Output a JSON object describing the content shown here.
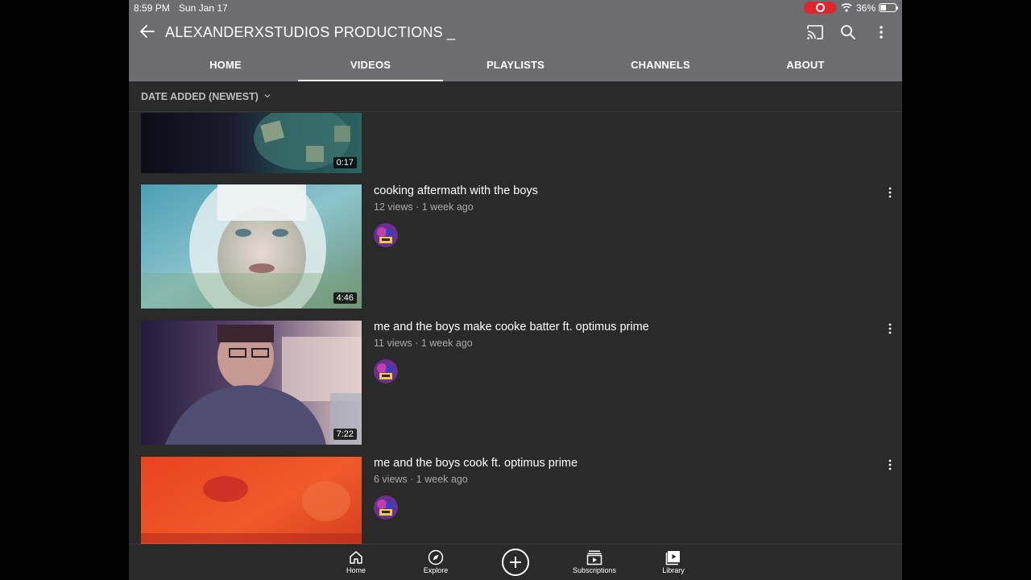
{
  "status_bar": {
    "time": "8:59 PM",
    "date": "Sun Jan 17",
    "battery": "36%",
    "recording_color": "#e0262d"
  },
  "header": {
    "title": "ALEXANDERXSTUDIOS PRODUCTIONS _",
    "background_color": "#6d6c6e",
    "icons": [
      "back-arrow-icon",
      "cast-icon",
      "search-icon",
      "more-vert-icon"
    ]
  },
  "tabs": [
    {
      "label": "HOME",
      "active": false
    },
    {
      "label": "VIDEOS",
      "active": true
    },
    {
      "label": "PLAYLISTS",
      "active": false
    },
    {
      "label": "CHANNELS",
      "active": false
    },
    {
      "label": "ABOUT",
      "active": false
    }
  ],
  "sort": {
    "label": "DATE ADDED (NEWEST)",
    "icon": "chevron-down-icon"
  },
  "videos": [
    {
      "title": "",
      "meta": "",
      "duration": "0:17"
    },
    {
      "title": "cooking aftermath with the boys",
      "meta": "12 views · 1 week ago",
      "duration": "4:46"
    },
    {
      "title": "me and the boys make cooke batter ft. optimus prime",
      "meta": "11 views · 1 week ago",
      "duration": "7:22"
    },
    {
      "title": "me and the boys cook ft. optimus prime",
      "meta": "6 views · 1 week ago",
      "duration": ""
    }
  ],
  "bottom_nav": [
    {
      "label": "Home",
      "icon": "home-icon"
    },
    {
      "label": "Explore",
      "icon": "compass-icon"
    },
    {
      "label": "",
      "icon": "create-plus-icon"
    },
    {
      "label": "Subscriptions",
      "icon": "subscriptions-icon"
    },
    {
      "label": "Library",
      "icon": "library-icon"
    }
  ],
  "colors": {
    "background": "#2a2a2b",
    "text_primary": "#ffffff",
    "text_secondary": "#aaaaaa"
  }
}
